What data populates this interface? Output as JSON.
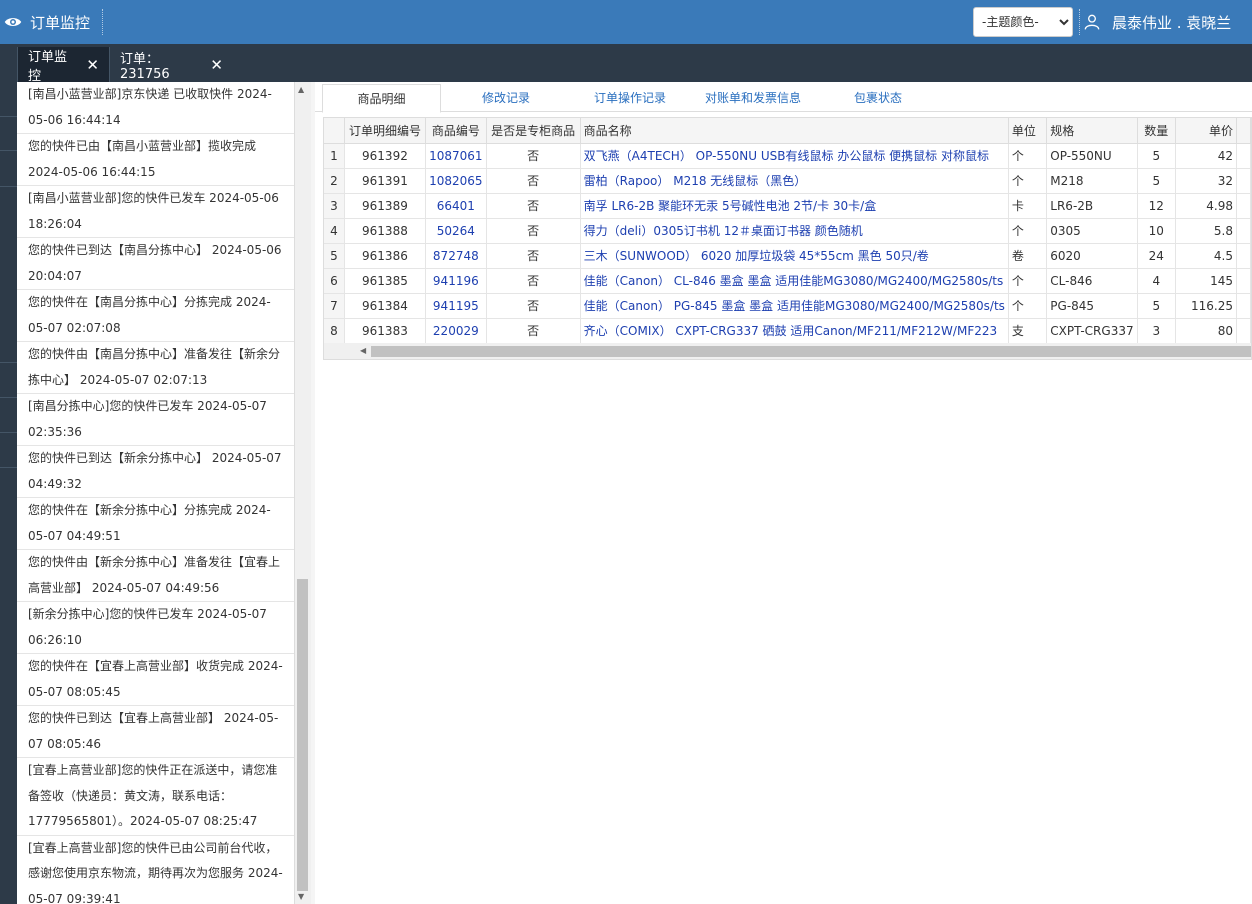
{
  "header": {
    "title": "订单监控",
    "theme_select": "-主题颜色-",
    "user_name": "晨泰伟业 . 袁晓兰"
  },
  "tabs": [
    {
      "label": "订单监控"
    },
    {
      "label": "订单：231756"
    }
  ],
  "logistics": [
    "[南昌小蓝营业部]京东快递 已收取快件 2024-05-06 16:44:14",
    "您的快件已由【南昌小蓝营业部】揽收完成 2024-05-06 16:44:15",
    "[南昌小蓝营业部]您的快件已发车 2024-05-06 18:26:04",
    "您的快件已到达【南昌分拣中心】 2024-05-06 20:04:07",
    "您的快件在【南昌分拣中心】分拣完成 2024-05-07 02:07:08",
    "您的快件由【南昌分拣中心】准备发往【新余分拣中心】 2024-05-07 02:07:13",
    "[南昌分拣中心]您的快件已发车 2024-05-07 02:35:36",
    "您的快件已到达【新余分拣中心】 2024-05-07 04:49:32",
    "您的快件在【新余分拣中心】分拣完成 2024-05-07 04:49:51",
    "您的快件由【新余分拣中心】准备发往【宜春上高营业部】 2024-05-07 04:49:56",
    "[新余分拣中心]您的快件已发车 2024-05-07 06:26:10",
    "您的快件在【宜春上高营业部】收货完成 2024-05-07 08:05:45",
    "您的快件已到达【宜春上高营业部】 2024-05-07 08:05:46",
    "[宜春上高营业部]您的快件正在派送中，请您准备签收（快递员：黄文涛，联系电话：17779565801）。2024-05-07 08:25:47",
    "[宜春上高营业部]您的快件已由公司前台代收，感谢您使用京东物流，期待再次为您服务 2024-05-07 09:39:41"
  ],
  "subtabs": [
    "商品明细",
    "修改记录",
    "订单操作记录",
    "对账单和发票信息",
    "包裹状态"
  ],
  "table": {
    "columns": [
      "订单明细编号",
      "商品编号",
      "是否是专柜商品",
      "商品名称",
      "单位",
      "规格",
      "数量",
      "单价"
    ],
    "rows": [
      {
        "n": "1",
        "detail_id": "961392",
        "sku": "1087061",
        "counter": "否",
        "name": "双飞燕（A4TECH） OP-550NU USB有线鼠标 办公鼠标 便携鼠标 对称鼠标",
        "unit": "个",
        "spec": "OP-550NU",
        "qty": "5",
        "price": "42"
      },
      {
        "n": "2",
        "detail_id": "961391",
        "sku": "1082065",
        "counter": "否",
        "name": "雷柏（Rapoo） M218 无线鼠标（黑色）",
        "unit": "个",
        "spec": "M218",
        "qty": "5",
        "price": "32"
      },
      {
        "n": "3",
        "detail_id": "961389",
        "sku": "66401",
        "counter": "否",
        "name": "南孚 LR6-2B 聚能环无汞 5号碱性电池 2节/卡 30卡/盒",
        "unit": "卡",
        "spec": "LR6-2B",
        "qty": "12",
        "price": "4.98"
      },
      {
        "n": "4",
        "detail_id": "961388",
        "sku": "50264",
        "counter": "否",
        "name": "得力（deli）0305订书机 12＃桌面订书器 颜色随机",
        "unit": "个",
        "spec": "0305",
        "qty": "10",
        "price": "5.8"
      },
      {
        "n": "5",
        "detail_id": "961386",
        "sku": "872748",
        "counter": "否",
        "name": "三木（SUNWOOD） 6020 加厚垃圾袋 45*55cm 黑色 50只/卷",
        "unit": "卷",
        "spec": "6020",
        "qty": "24",
        "price": "4.5"
      },
      {
        "n": "6",
        "detail_id": "961385",
        "sku": "941196",
        "counter": "否",
        "name": "佳能（Canon） CL-846 墨盒 墨盒 适用佳能MG3080/MG2400/MG2580s/ts",
        "unit": "个",
        "spec": "CL-846",
        "qty": "4",
        "price": "145"
      },
      {
        "n": "7",
        "detail_id": "961384",
        "sku": "941195",
        "counter": "否",
        "name": "佳能（Canon） PG-845 墨盒 墨盒 适用佳能MG3080/MG2400/MG2580s/ts",
        "unit": "个",
        "spec": "PG-845",
        "qty": "5",
        "price": "116.25"
      },
      {
        "n": "8",
        "detail_id": "961383",
        "sku": "220029",
        "counter": "否",
        "name": "齐心（COMIX） CXPT-CRG337 硒鼓 适用Canon/MF211/MF212W/MF223",
        "unit": "支",
        "spec": "CXPT-CRG337",
        "qty": "3",
        "price": "80"
      }
    ]
  }
}
